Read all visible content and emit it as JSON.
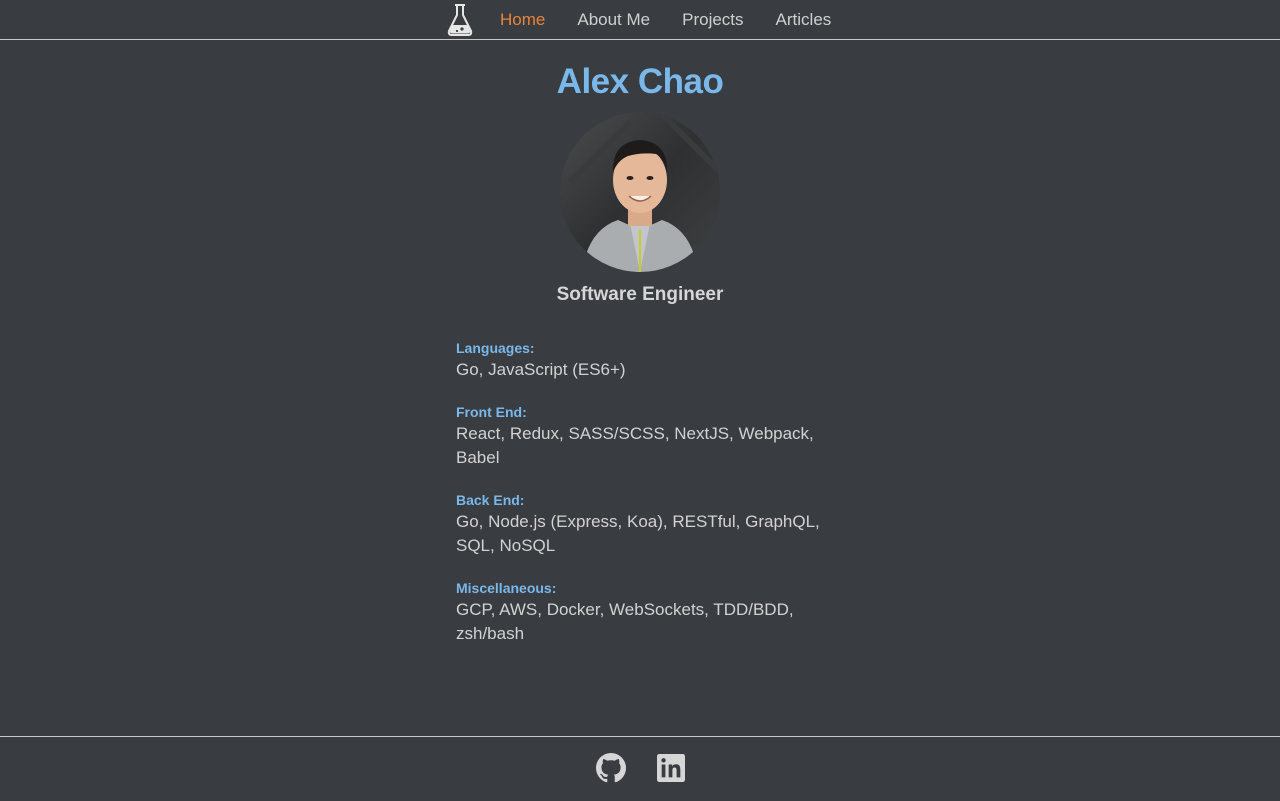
{
  "nav": {
    "logo_icon": "flask-icon",
    "items": [
      {
        "label": "Home",
        "active": true
      },
      {
        "label": "About Me",
        "active": false
      },
      {
        "label": "Projects",
        "active": false
      },
      {
        "label": "Articles",
        "active": false
      }
    ]
  },
  "profile": {
    "name": "Alex Chao",
    "role": "Software Engineer",
    "avatar_icon": "profile-photo"
  },
  "skills": [
    {
      "label": "Languages:",
      "value": "Go, JavaScript (ES6+)"
    },
    {
      "label": "Front End:",
      "value": "React, Redux, SASS/SCSS, NextJS, Webpack, Babel"
    },
    {
      "label": "Back End:",
      "value": "Go, Node.js (Express, Koa), RESTful, GraphQL, SQL, NoSQL"
    },
    {
      "label": "Miscellaneous:",
      "value": "GCP, AWS, Docker, WebSockets, TDD/BDD, zsh/bash"
    }
  ],
  "footer": {
    "links": [
      {
        "icon": "github-icon"
      },
      {
        "icon": "linkedin-icon"
      }
    ]
  },
  "colors": {
    "background": "#393c40",
    "accent_blue": "#7ab8ea",
    "active_orange": "#e8843c",
    "text": "#d2d2d2"
  }
}
